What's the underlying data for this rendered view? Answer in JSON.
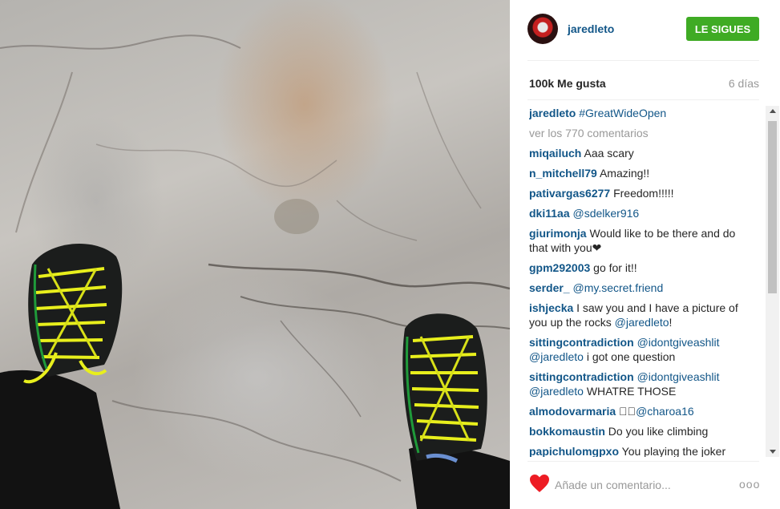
{
  "header": {
    "username": "jaredleto",
    "follow_label": "LE SIGUES",
    "follow_color": "#3fab24"
  },
  "stats": {
    "likes": "100k Me gusta",
    "age": "6 días"
  },
  "caption": {
    "user": "jaredleto",
    "hashtag": "#GreatWideOpen"
  },
  "view_all": "ver los 770 comentarios",
  "comments": [
    {
      "user": "miqailuch",
      "text": "Aaa scary"
    },
    {
      "user": "n_mitchell79",
      "text": "Amazing!!"
    },
    {
      "user": "pativargas6277",
      "text": "Freedom!!!!!"
    },
    {
      "user": "dki11aa",
      "mention": "@sdelker916"
    },
    {
      "user": "giurimonja",
      "text": "Would like to be there and do that with you❤"
    },
    {
      "user": "gpm292003",
      "text": "go for it!!"
    },
    {
      "user": "serder_",
      "mention": "@my.secret.friend"
    },
    {
      "user": "ishjecka",
      "text": "I saw you and I have a picture of you up the rocks",
      "mention": "@jaredleto",
      "after": "!"
    },
    {
      "user": "sittingcontradiction",
      "mention": "@idontgiveashlit",
      "mention2": "@jaredleto",
      "after": "i got one question"
    },
    {
      "user": "sittingcontradiction",
      "mention": "@idontgiveashlit",
      "mention2": "@jaredleto",
      "after": "WHATRE THOSE"
    },
    {
      "user": "almodovarmaria",
      "symbol": "⃞⃞",
      "mention": "@charoa16"
    },
    {
      "user": "bokkomaustin",
      "text": "Do you like climbing"
    },
    {
      "user": "papichulomgpxo",
      "text": "You playing the joker"
    }
  ],
  "footer": {
    "placeholder": "Añade un comentario...",
    "options": "ooo",
    "heart_color": "#ed1c24"
  },
  "colors": {
    "link": "#125688",
    "text": "#262626",
    "muted": "#999999"
  }
}
